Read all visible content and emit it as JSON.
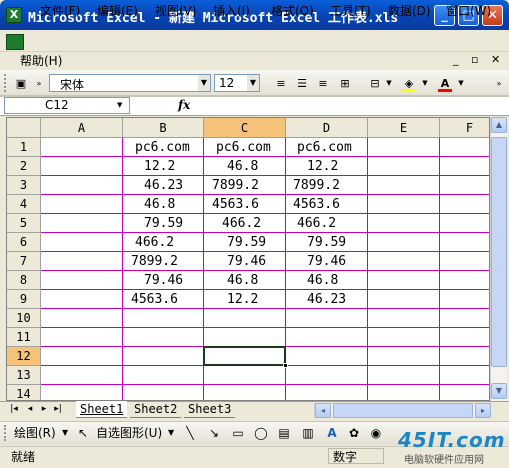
{
  "window": {
    "title": "Microsoft Excel - 新建 Microsoft Excel 工作表.xls",
    "minimize": "_",
    "maximize": "□",
    "close": "✕"
  },
  "menu": {
    "items": [
      "文件(F)",
      "编辑(E)",
      "视图(V)",
      "插入(I)",
      "格式(O)",
      "工具(T)",
      "数据(D)",
      "窗口(W)"
    ],
    "help": "帮助(H)"
  },
  "toolbar": {
    "font": "宋体",
    "size": "12",
    "fill_color": "#ffff00",
    "font_color": "#ff0000"
  },
  "formula_bar": {
    "name_box": "C12",
    "fx": "fx",
    "content": ""
  },
  "grid": {
    "columns": [
      "A",
      "B",
      "C",
      "D",
      "E",
      "F"
    ],
    "rows": [
      "1",
      "2",
      "3",
      "4",
      "5",
      "6",
      "7",
      "8",
      "9",
      "10",
      "11",
      "12",
      "13",
      "14"
    ],
    "selected_cell": "C12",
    "cells": {
      "B": [
        "pc6.com",
        "12.2",
        "46.23",
        "46.8",
        "79.59",
        "466.2",
        "7899.2",
        "79.46",
        "4563.6"
      ],
      "C": [
        "pc6.com",
        "46.8",
        "7899.2",
        "4563.6",
        "466.2",
        "79.59",
        "79.46",
        "46.8",
        "12.2"
      ],
      "D": [
        "pc6.com",
        "12.2",
        "7899.2",
        "4563.6",
        "466.2",
        "79.59",
        "79.46",
        "46.8",
        "46.23"
      ]
    },
    "gridline_color": "#c200c2"
  },
  "sheets": {
    "tabs": [
      "Sheet1",
      "Sheet2",
      "Sheet3"
    ],
    "active": "Sheet1"
  },
  "draw_toolbar": {
    "draw": "绘图(R)",
    "autoshapes": "自选图形(U)"
  },
  "status": {
    "ready": "就绪",
    "mode": "数字"
  },
  "watermark": {
    "logo": "45IT.com",
    "sub": "电脑软硬件应用网"
  }
}
